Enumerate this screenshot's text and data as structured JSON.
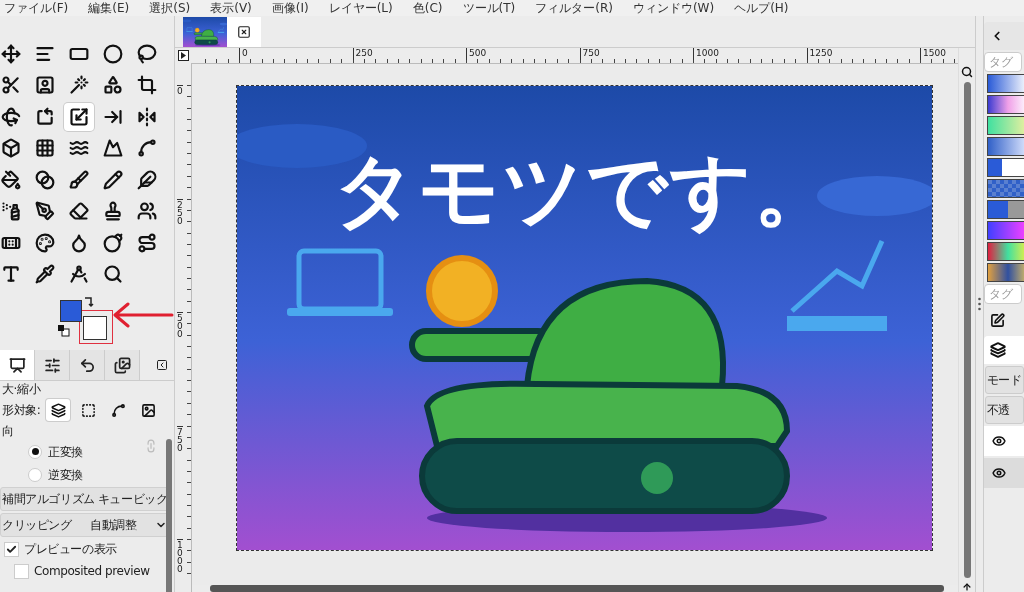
{
  "menu": [
    {
      "label": "ファイル(F)"
    },
    {
      "label": "編集(E)"
    },
    {
      "label": "選択(S)"
    },
    {
      "label": "表示(V)"
    },
    {
      "label": "画像(I)"
    },
    {
      "label": "レイヤー(L)"
    },
    {
      "label": "色(C)"
    },
    {
      "label": "ツール(T)"
    },
    {
      "label": "フィルター(R)"
    },
    {
      "label": "ウィンドウ(W)"
    },
    {
      "label": "ヘルプ(H)"
    }
  ],
  "toolbox": {
    "tools": [
      {
        "selected": false
      },
      {
        "selected": false
      },
      {
        "selected": false
      },
      {
        "selected": false
      },
      {
        "selected": false
      },
      {
        "selected": false
      },
      {
        "selected": false
      },
      {
        "selected": false
      },
      {
        "selected": false
      },
      {
        "selected": false
      },
      {
        "selected": false
      },
      {
        "selected": false
      },
      {
        "selected": true
      },
      {
        "selected": false
      },
      {
        "selected": false
      },
      {
        "selected": false
      },
      {
        "selected": false
      },
      {
        "selected": false
      },
      {
        "selected": false
      },
      {
        "selected": false
      },
      {
        "selected": false
      },
      {
        "selected": false
      },
      {
        "selected": false
      },
      {
        "selected": false
      },
      {
        "selected": false
      },
      {
        "selected": false
      },
      {
        "selected": false
      },
      {
        "selected": false
      },
      {
        "selected": false
      },
      {
        "selected": false
      },
      {
        "selected": false
      },
      {
        "selected": false
      },
      {
        "selected": false
      },
      {
        "selected": false
      },
      {
        "selected": false
      },
      {
        "selected": false
      },
      {
        "selected": false
      },
      {
        "selected": false
      },
      {
        "selected": false
      }
    ]
  },
  "dock_tabs": [
    {
      "selected": true
    },
    {
      "selected": false
    },
    {
      "selected": false
    },
    {
      "selected": false
    }
  ],
  "tool_options": {
    "title": "大·縮小",
    "transform_label": "形対象:",
    "transform_targets": [
      {
        "selected": true
      },
      {
        "selected": false
      },
      {
        "selected": false
      },
      {
        "selected": false
      }
    ],
    "direction_label": "向",
    "directions": [
      {
        "label": "正変換",
        "selected": true
      },
      {
        "label": "逆変換",
        "selected": false
      }
    ],
    "dropdowns": [
      {
        "label": "補間アルゴリズム",
        "value": "キュービック"
      },
      {
        "label": "クリッピング",
        "value": "自動調整"
      }
    ],
    "checks": [
      {
        "label": "プレビューの表示",
        "checked": true
      },
      {
        "label": "Composited preview",
        "checked": false
      }
    ]
  },
  "image_tabs": [
    {
      "selected": true
    }
  ],
  "rulers": {
    "horizontal": [
      "0",
      "250",
      "500",
      "750",
      "1000",
      "1250",
      "1500"
    ],
    "vertical": [
      "0",
      "250",
      "500",
      "750",
      "1000"
    ]
  },
  "canvas": {
    "title": "タモツです。"
  },
  "right_panel": {
    "tag_placeholder": "タグ",
    "tag_placeholder_2": "タグ",
    "mode_label": "モード",
    "opacity_label": "不透",
    "layers": [
      {
        "visible": true,
        "selected": false
      },
      {
        "visible": true,
        "selected": true
      }
    ]
  }
}
